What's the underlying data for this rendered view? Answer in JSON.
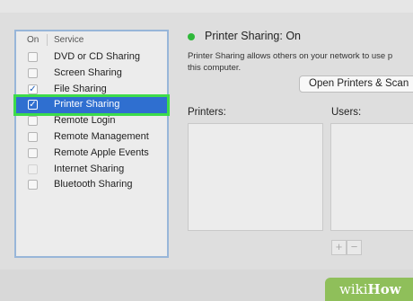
{
  "services": {
    "header_on": "On",
    "header_service": "Service",
    "items": [
      {
        "label": "DVD or CD Sharing",
        "checked": false,
        "selected": false,
        "faded": false
      },
      {
        "label": "Screen Sharing",
        "checked": false,
        "selected": false,
        "faded": false
      },
      {
        "label": "File Sharing",
        "checked": true,
        "selected": false,
        "faded": false
      },
      {
        "label": "Printer Sharing",
        "checked": true,
        "selected": true,
        "faded": false
      },
      {
        "label": "Remote Login",
        "checked": false,
        "selected": false,
        "faded": false
      },
      {
        "label": "Remote Management",
        "checked": false,
        "selected": false,
        "faded": false
      },
      {
        "label": "Remote Apple Events",
        "checked": false,
        "selected": false,
        "faded": false
      },
      {
        "label": "Internet Sharing",
        "checked": false,
        "selected": false,
        "faded": true
      },
      {
        "label": "Bluetooth Sharing",
        "checked": false,
        "selected": false,
        "faded": false
      }
    ]
  },
  "status": {
    "text": "Printer Sharing: On",
    "color": "#2fb83a"
  },
  "description": {
    "line1": "Printer Sharing allows others on your network to use p",
    "line2": "this computer."
  },
  "open_button": {
    "label": "Open Printers & Scan"
  },
  "printers": {
    "label": "Printers:"
  },
  "users": {
    "label": "Users:",
    "add_label": "+",
    "remove_label": "−"
  },
  "watermark": {
    "prefix": "wiki",
    "suffix": "How"
  },
  "colors": {
    "selection": "#2f6fd0",
    "highlight_outline": "#3ddc4a",
    "status_on": "#2fb83a",
    "wikihow_green": "#8fbf5a"
  }
}
